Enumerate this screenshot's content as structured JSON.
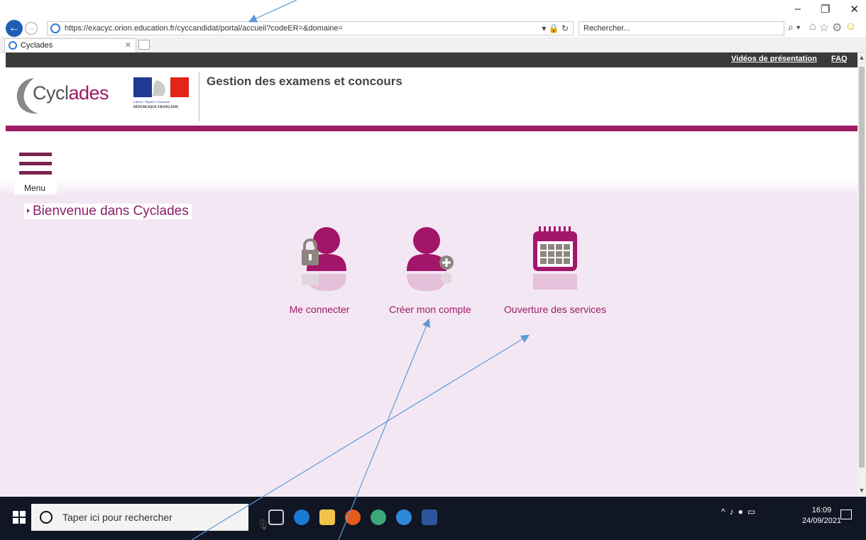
{
  "browser": {
    "url": "https://exacyc.orion.education.fr/cyccandidat/portal/accueil?codeER=&domaine=",
    "search_placeholder": "Rechercher...",
    "tab_title": "Cyclades",
    "controls": {
      "minimize": "–",
      "restore": "❐",
      "close": "✕",
      "tab_close": "✕"
    }
  },
  "topbar": {
    "videos": "Vidéos de présentation",
    "faq": "FAQ"
  },
  "header": {
    "logo_text_1": "Cycl",
    "logo_text_2": "ades",
    "app_title": "Gestion des examens et concours",
    "marianne_caption": "Liberté • Égalité • Fraternité",
    "marianne_name": "RÉPUBLIQUE FRANÇAISE"
  },
  "menu": {
    "label": "Menu"
  },
  "welcome": "Bienvenue dans Cyclades",
  "tiles": [
    {
      "label": "Me connecter",
      "icon": "lock-user-icon"
    },
    {
      "label": "Créer mon compte",
      "icon": "add-user-icon"
    },
    {
      "label": "Ouverture des services",
      "icon": "calendar-icon"
    }
  ],
  "colors": {
    "accent": "#9b1b65",
    "topbar": "#3a3a3a",
    "background": "#f4e7f4"
  },
  "taskbar": {
    "search_placeholder": "Taper ici pour rechercher",
    "time": "16:09",
    "date": "24/09/2021"
  }
}
